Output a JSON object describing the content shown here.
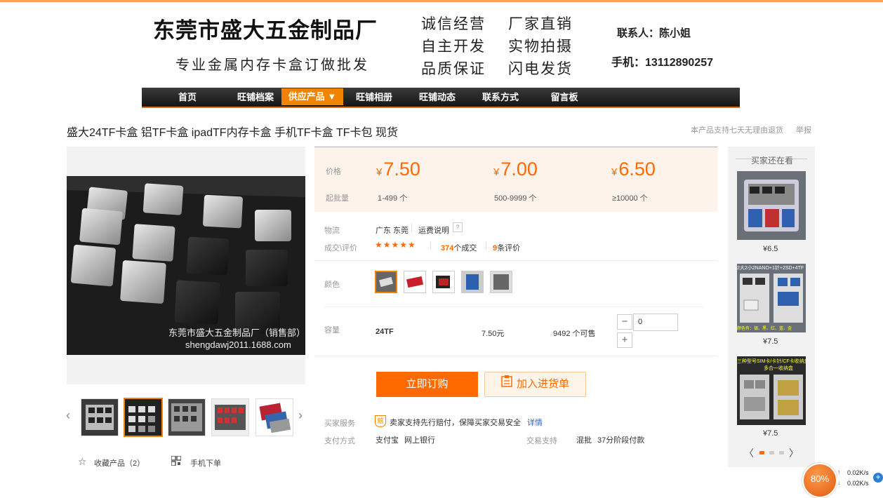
{
  "header": {
    "company_name": "东莞市盛大五金制品厂",
    "company_sub": "专业金属内存卡盒订做批发",
    "slogans": [
      "诚信经营",
      "厂家直销",
      "自主开发",
      "实物拍摄",
      "品质保证",
      "闪电发货"
    ],
    "contact_person": "联系人：陈小姐",
    "phone": "手机：13112890257"
  },
  "nav": {
    "items": [
      "首页",
      "旺铺档案",
      "供应产品 ▼",
      "旺铺相册",
      "旺铺动态",
      "联系方式",
      "留言板"
    ],
    "active_index": 2
  },
  "product": {
    "title": "盛大24TF卡盒 铝TF卡盒 ipadTF内存卡盒 手机TF卡盒 TF卡包 现货",
    "return_note": "本产品支持七天无理由退货",
    "report": "举报",
    "watermark_line1": "东莞市盛大五金制品厂（销售部）",
    "watermark_line2": "shengdawj2011.1688.com",
    "favorite": "收藏产品（2）",
    "mobile_order": "手机下单"
  },
  "pricing": {
    "price_label": "价格",
    "moq_label": "起批量",
    "currency": "¥",
    "tiers": [
      {
        "price": "7.50",
        "range": "1-499 个"
      },
      {
        "price": "7.00",
        "range": "500-9999 个"
      },
      {
        "price": "6.50",
        "range": "≥10000 个"
      }
    ]
  },
  "logistics": {
    "label": "物流",
    "location": "广东 东莞",
    "shipping_note": "运费说明",
    "help": "?"
  },
  "reviews": {
    "label": "成交\\评价",
    "stars": "★★★★★",
    "deals_count": "374",
    "deals_suffix": "个成交",
    "reviews_count": "9",
    "reviews_suffix": "条评价"
  },
  "options": {
    "color_label": "颜色",
    "capacity_label": "容量",
    "capacity_value": "24TF",
    "unit_price": "7.50元",
    "stock": "9492 个可售",
    "quantity": "0",
    "minus": "−",
    "plus": "+"
  },
  "actions": {
    "order_now": "立即订购",
    "add_to_cart": "加入进货单"
  },
  "services": {
    "buyer_service_label": "买家服务",
    "buyer_service_badge": "赔",
    "buyer_service_text": "卖家支持先行赔付，保障买家交易安全",
    "details": "详情",
    "payment_label": "支付方式",
    "payment_alipay": "支付宝",
    "payment_bank": "网上银行",
    "trade_label": "交易支持",
    "trade_mixed": "混批",
    "trade_installment": "37分阶段付款"
  },
  "sidebar": {
    "title": "买家还在看",
    "items": [
      {
        "price": "¥6.5"
      },
      {
        "price": "¥7.5",
        "img_text": "2大2小2NANO+1针+2SD+4TF",
        "img_text2": "颜色有：银、黑、红、蓝、金"
      },
      {
        "price": "¥7.5",
        "img_text": "三种型号SIM卡/卡针/CF卡收纳盒",
        "img_text2": "多合一收纳盒"
      }
    ],
    "prev": "〈",
    "next": "〉"
  },
  "speed_widget": {
    "percent": "80%",
    "up": "0.02K/s",
    "down": "0.02K/s",
    "up_arrow": "↑",
    "down_arrow": "↓",
    "plus": "+"
  },
  "colors": {
    "accent": "#ff6a00",
    "nav_active": "#f08400",
    "price_bg": "#fdf3ea"
  }
}
